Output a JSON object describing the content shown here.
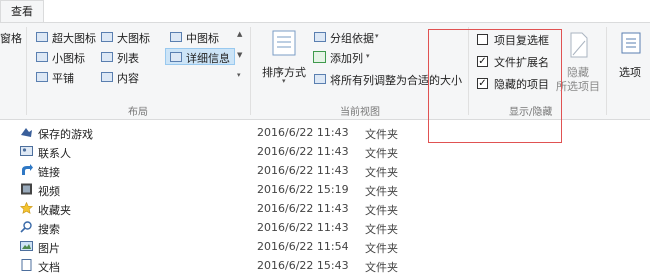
{
  "tabs": {
    "view_tab": "查看"
  },
  "layout_group": {
    "left_cut": "窗格",
    "items": [
      "超大图标",
      "大图标",
      "中图标",
      "小图标",
      "列表",
      "详细信息",
      "平铺",
      "内容"
    ],
    "group_label": "布局"
  },
  "current_view": {
    "sort_label": "排序方式",
    "group_by": "分组依据",
    "add_column": "添加列",
    "fit_columns": "将所有列调整为合适的大小",
    "group_label": "当前视图"
  },
  "show_hide": {
    "item_checkboxes": "项目复选框",
    "file_extensions": "文件扩展名",
    "hidden_items": "隐藏的项目",
    "item_checkboxes_checked": false,
    "file_extensions_checked": true,
    "hidden_items_checked": true,
    "hide_selected_line1": "隐藏",
    "hide_selected_line2": "所选项目",
    "group_label": "显示/隐藏"
  },
  "options": {
    "label": "选项"
  },
  "files": [
    {
      "name": "保存的游戏",
      "date": "2016/6/22 11:43",
      "type": "文件夹",
      "icon": "saved-games-icon"
    },
    {
      "name": "联系人",
      "date": "2016/6/22 11:43",
      "type": "文件夹",
      "icon": "contacts-icon"
    },
    {
      "name": "链接",
      "date": "2016/6/22 11:43",
      "type": "文件夹",
      "icon": "links-icon"
    },
    {
      "name": "视频",
      "date": "2016/6/22 15:19",
      "type": "文件夹",
      "icon": "videos-icon"
    },
    {
      "name": "收藏夹",
      "date": "2016/6/22 11:43",
      "type": "文件夹",
      "icon": "favorites-icon"
    },
    {
      "name": "搜索",
      "date": "2016/6/22 11:43",
      "type": "文件夹",
      "icon": "searches-icon"
    },
    {
      "name": "图片",
      "date": "2016/6/22 11:54",
      "type": "文件夹",
      "icon": "pictures-icon"
    },
    {
      "name": "文档",
      "date": "2016/6/22 15:43",
      "type": "文件夹",
      "icon": "documents-icon"
    }
  ],
  "colors": {
    "highlight_box": "#e05252",
    "selected_bg": "#cce4f7",
    "ribbon_bg": "#f5f6f7"
  }
}
